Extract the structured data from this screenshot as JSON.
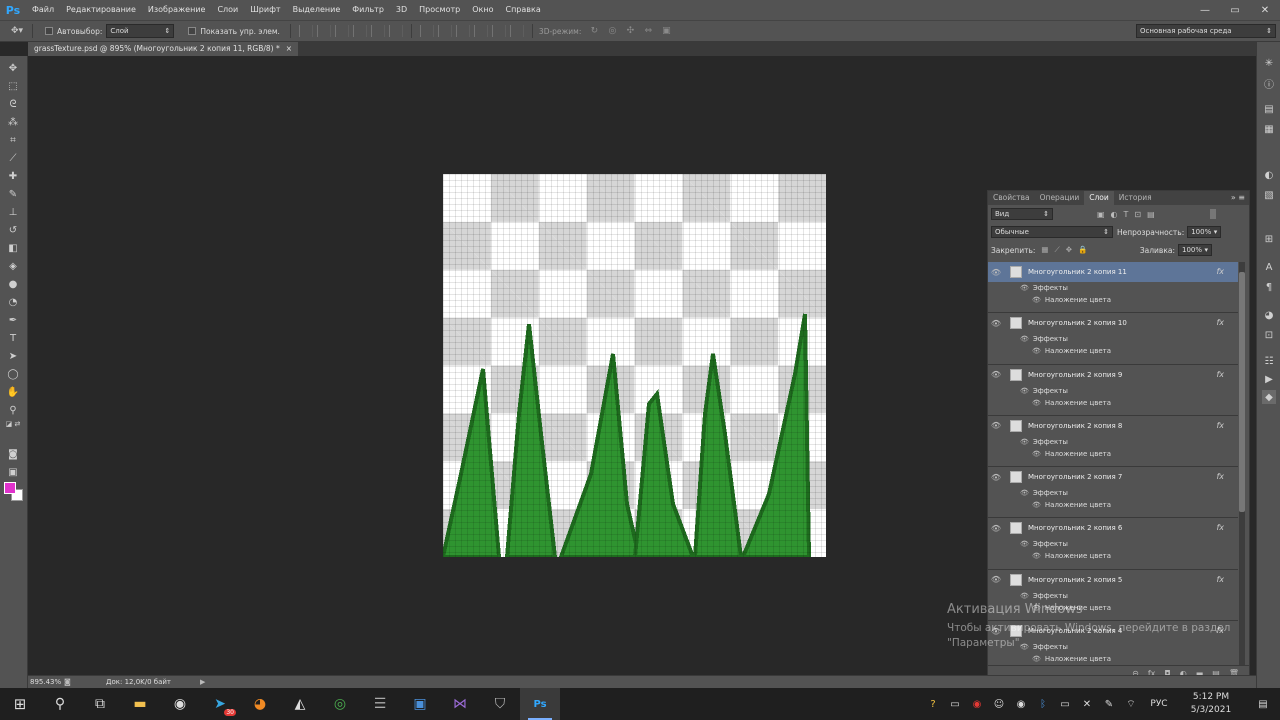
{
  "app": {
    "logo": "Ps"
  },
  "menubar": {
    "items": [
      "Файл",
      "Редактирование",
      "Изображение",
      "Слои",
      "Шрифт",
      "Выделение",
      "Фильтр",
      "3D",
      "Просмотр",
      "Окно",
      "Справка"
    ]
  },
  "options": {
    "auto_select_label": "Автовыбор:",
    "auto_select_value": "Слой",
    "show_controls_label": "Показать упр. элем.",
    "mode3d_label": "3D-режим:",
    "workspace": "Основная рабочая среда"
  },
  "document": {
    "tab_title": "grassTexture.psd @ 895% (Многоугольник 2 копия 11, RGB/8) *",
    "close": "×"
  },
  "status": {
    "zoom": "895.43%",
    "doc": "Док: 12,0K/0 байт"
  },
  "colors": {
    "foreground": "#e033cc",
    "background": "#ffffff",
    "grass_dark": "#1e6b1e",
    "grass_mid": "#2f9430",
    "grass_light": "#58b04f"
  },
  "panel": {
    "tabs": [
      "Свойства",
      "Операции",
      "Слои",
      "История"
    ],
    "active_tab": "Слои",
    "filter_kind": "Вид",
    "blend_mode": "Обычные",
    "opacity_label": "Непрозрачность:",
    "opacity_value": "100%",
    "lock_label": "Закрепить:",
    "fill_label": "Заливка:",
    "fill_value": "100%",
    "layers": [
      {
        "name": "Многоугольник 2 копия 11",
        "effects": "Эффекты",
        "effect": "Наложение цвета",
        "selected": true
      },
      {
        "name": "Многоугольник 2 копия 10",
        "effects": "Эффекты",
        "effect": "Наложение цвета"
      },
      {
        "name": "Многоугольник 2 копия 9",
        "effects": "Эффекты",
        "effect": "Наложение цвета"
      },
      {
        "name": "Многоугольник 2 копия 8",
        "effects": "Эффекты",
        "effect": "Наложение цвета"
      },
      {
        "name": "Многоугольник 2 копия 7",
        "effects": "Эффекты",
        "effect": "Наложение цвета"
      },
      {
        "name": "Многоугольник 2 копия 6",
        "effects": "Эффекты",
        "effect": "Наложение цвета"
      },
      {
        "name": "Многоугольник 2 копия 5",
        "effects": "Эффекты",
        "effect": "Наложение цвета"
      },
      {
        "name": "Многоугольник 2 копия 4",
        "effects": "Эффекты",
        "effect": "Наложение цвета"
      }
    ],
    "fx_label": "fx"
  },
  "watermark": {
    "line1": "Активация Windows",
    "line2": "Чтобы активировать Windows, перейдите в раздел",
    "line3": "\"Параметры\"."
  },
  "taskbar": {
    "lang": "РУС",
    "time": "5:12 PM",
    "date": "5/3/2021",
    "telegram_badge": "30"
  }
}
